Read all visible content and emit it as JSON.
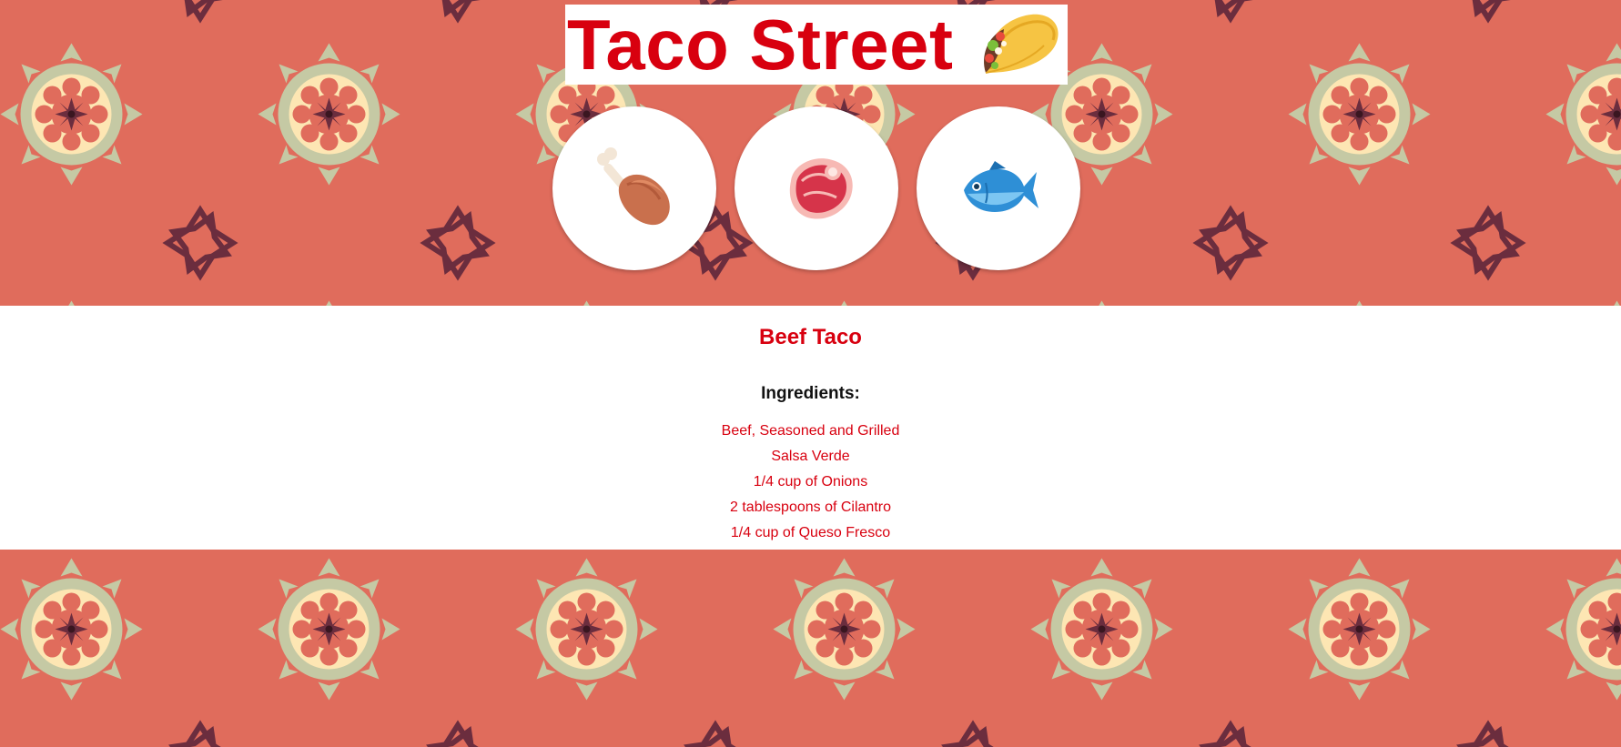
{
  "header": {
    "title": "Taco Street",
    "title_icon": "taco-icon"
  },
  "meat_options": [
    {
      "name": "chicken",
      "icon": "poultry-leg-icon"
    },
    {
      "name": "beef",
      "icon": "cut-of-meat-icon"
    },
    {
      "name": "fish",
      "icon": "fish-icon"
    }
  ],
  "recipe": {
    "title": "Beef Taco",
    "ingredients_heading": "Ingredients:",
    "ingredients": [
      "Beef, Seasoned and Grilled",
      "Salsa Verde",
      "1/4 cup of Onions",
      "2 tablespoons of Cilantro",
      "1/4 cup of Queso Fresco"
    ]
  },
  "colors": {
    "brand_red": "#d8000f",
    "background_coral": "#e06c5c",
    "pattern_sage": "#c5c9a4",
    "pattern_cream": "#fde6b3",
    "pattern_plum": "#6b2d3e"
  }
}
